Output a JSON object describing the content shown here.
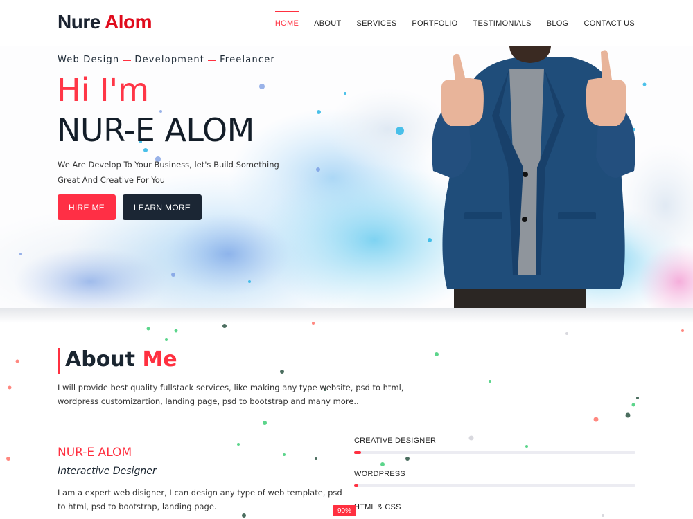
{
  "brand": {
    "part1": "Nure ",
    "part2": "Alom"
  },
  "nav": {
    "items": [
      {
        "label": "HOME",
        "active": true
      },
      {
        "label": "ABOUT"
      },
      {
        "label": "SERVICES"
      },
      {
        "label": "PORTFOLIO"
      },
      {
        "label": "TESTIMONIALS"
      },
      {
        "label": "BLOG"
      },
      {
        "label": "CONTACT US"
      }
    ]
  },
  "hero": {
    "tagline": [
      "Web Design",
      "Development",
      "Freelancer"
    ],
    "greeting": "Hi I'm",
    "name": "NUR-E ALOM",
    "description": "We Are Develop To Your Business, let's Build Something Great And Creative For You",
    "buttons": {
      "hire": "HIRE ME",
      "learn": "LEARN MORE"
    }
  },
  "about": {
    "title_part1": "About ",
    "title_part2": "Me",
    "description": "I will provide best quality fullstack services, like making any type website, psd to html, wordpress customizartion, landing page, psd to bootstrap and many more..",
    "profile": {
      "name": "NUR-E ALOM",
      "role": "Interactive Designer",
      "description": "I am a expert web disigner, I can design any type of web template, psd to html, psd to bootstrap, landing page."
    },
    "skills": [
      {
        "label": "CREATIVE DESIGNER"
      },
      {
        "label": "WORDPRESS"
      },
      {
        "label": "HTML & CSS",
        "badge": "90%"
      }
    ]
  },
  "colors": {
    "accent": "#ff3040",
    "dark": "#1b2634",
    "brand_red": "#e00b1c"
  }
}
